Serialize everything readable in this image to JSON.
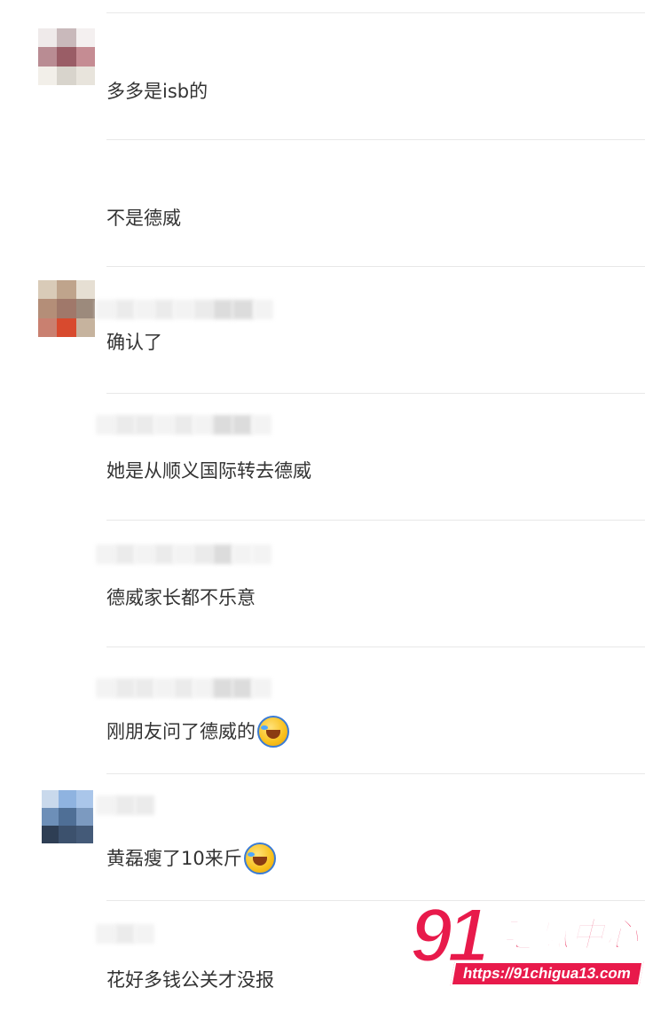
{
  "comments": [
    {
      "text": "多多是isb的",
      "has_avatar": true,
      "emoji": null
    },
    {
      "text": "不是德威",
      "has_avatar": false,
      "emoji": null
    },
    {
      "text": "确认了",
      "has_avatar": true,
      "emoji": null
    },
    {
      "text": "她是从顺义国际转去德威",
      "has_avatar": false,
      "emoji": null
    },
    {
      "text": "德威家长都不乐意",
      "has_avatar": false,
      "emoji": null
    },
    {
      "text": "刚朋友问了德威的",
      "has_avatar": false,
      "emoji": "laughing-crying-emoji"
    },
    {
      "text": "黄磊瘦了10来斤",
      "has_avatar": true,
      "emoji": "laughing-crying-emoji"
    },
    {
      "text": "花好多钱公关才没报",
      "has_avatar": false,
      "emoji": null
    }
  ],
  "watermark": {
    "number": "91",
    "title": "吃瓜中心",
    "url": "https://91chigua13.com"
  },
  "colors": {
    "text": "#333333",
    "divider": "#e8e8e8",
    "watermark_red": "#e81a4b"
  }
}
